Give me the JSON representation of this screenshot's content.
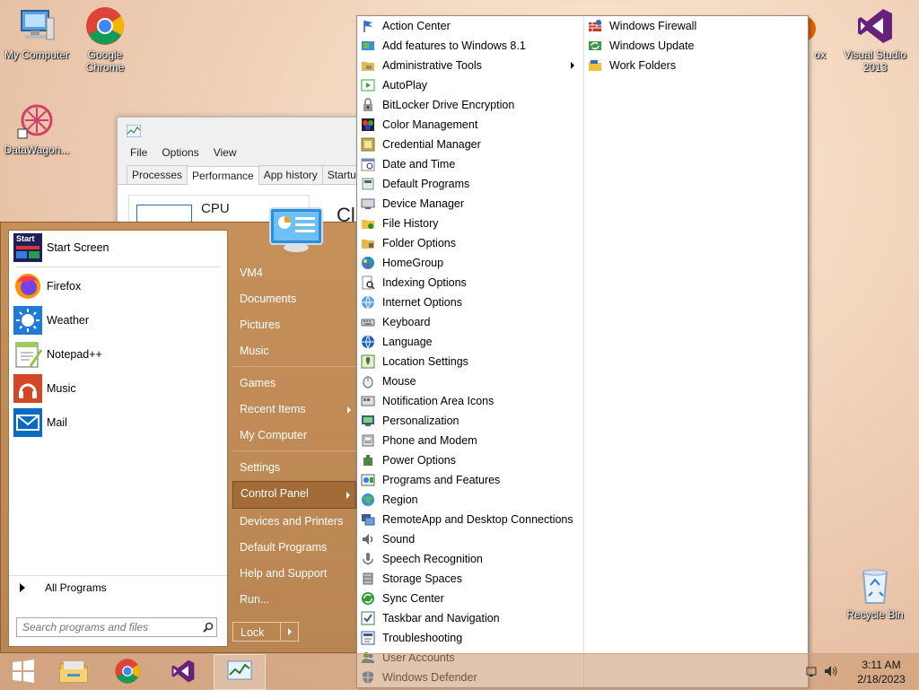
{
  "desktop": {
    "icons": [
      {
        "label": "My Computer"
      },
      {
        "label": "Google Chrome"
      },
      {
        "label": "DataWagon..."
      },
      {
        "label": "ox"
      },
      {
        "label": "Visual Studio 2013"
      },
      {
        "label": "Recycle Bin"
      }
    ]
  },
  "taskmanager": {
    "menu": [
      "File",
      "Options",
      "View"
    ],
    "tabs": [
      "Processes",
      "Performance",
      "App history",
      "Startu"
    ],
    "cpu_label": "CPU",
    "cpu_fragment": "Cl"
  },
  "start_menu": {
    "pinned": [
      {
        "label": "Start Screen",
        "icon": "start-screen-icon",
        "tile_text": "Start"
      },
      {
        "label": "Firefox",
        "icon": "firefox-icon"
      },
      {
        "label": "Weather",
        "icon": "weather-icon"
      },
      {
        "label": "Notepad++",
        "icon": "notepad-icon"
      },
      {
        "label": "Music",
        "icon": "music-icon"
      },
      {
        "label": "Mail",
        "icon": "mail-icon"
      }
    ],
    "all_programs": "All Programs",
    "search_placeholder": "Search programs and files",
    "right": [
      {
        "label": "VM4"
      },
      {
        "label": "Documents"
      },
      {
        "label": "Pictures"
      },
      {
        "label": "Music"
      },
      {
        "label": "Games"
      },
      {
        "label": "Recent Items"
      },
      {
        "label": "My Computer"
      },
      {
        "label": "Settings"
      },
      {
        "label": "Control Panel"
      },
      {
        "label": "Devices and Printers"
      },
      {
        "label": "Default Programs"
      },
      {
        "label": "Help and Support"
      },
      {
        "label": "Run..."
      }
    ],
    "lock_label": "Lock"
  },
  "control_panel": {
    "col1": [
      "Action Center",
      "Add features to Windows 8.1",
      "Administrative Tools",
      "AutoPlay",
      "BitLocker Drive Encryption",
      "Color Management",
      "Credential Manager",
      "Date and Time",
      "Default Programs",
      "Device Manager",
      "File History",
      "Folder Options",
      "HomeGroup",
      "Indexing Options",
      "Internet Options",
      "Keyboard",
      "Language",
      "Location Settings",
      "Mouse",
      "Notification Area Icons",
      "Personalization",
      "Phone and Modem",
      "Power Options",
      "Programs and Features",
      "Region",
      "RemoteApp and Desktop Connections",
      "Sound",
      "Speech Recognition",
      "Storage Spaces",
      "Sync Center",
      "Taskbar and Navigation",
      "Troubleshooting",
      "User Accounts",
      "Windows Defender"
    ],
    "col2": [
      "Windows Firewall",
      "Windows Update",
      "Work Folders"
    ]
  },
  "taskbar": {
    "time": "3:11 AM",
    "date": "2/18/2023"
  }
}
